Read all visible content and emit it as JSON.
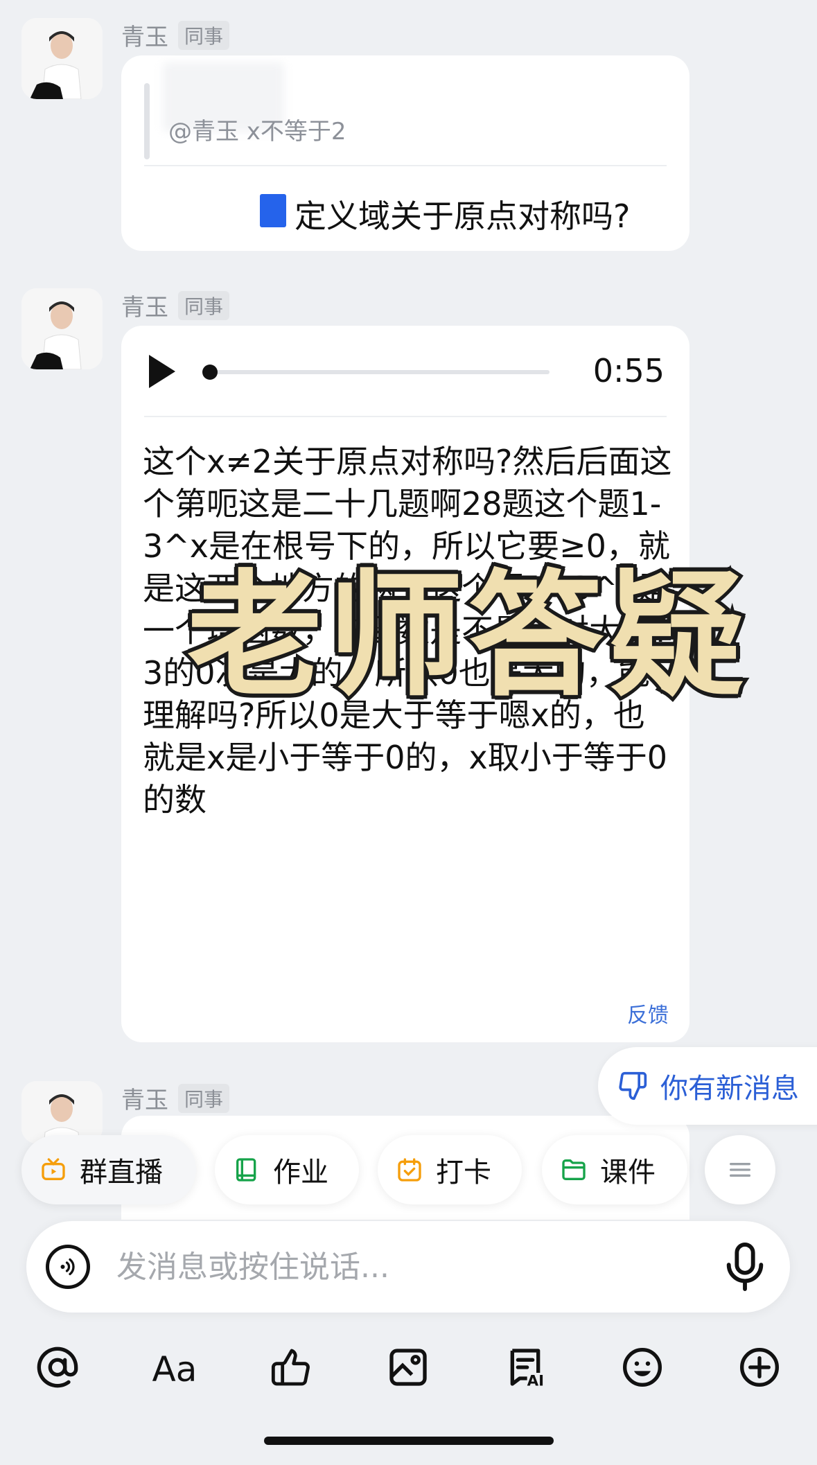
{
  "messages": [
    {
      "sender": "青玉",
      "badge": "同事",
      "quote_text": "@青玉 x不等于2",
      "reply_text": "定义域关于原点对称吗?"
    },
    {
      "sender": "青玉",
      "badge": "同事",
      "voice_duration": "0:55",
      "voice_progress": 0,
      "transcript": "这个x≠2关于原点对称吗?然后后面这个第呃这是二十几题啊28题这个题1-3^x是在根号下的，所以它要≥0，就是这两个地方的两个这个嗯y=3^x是一个增函数，增函数是不是大对大呀?3的0次是大的，所以0也是大的，能理解吗?所以0是大于等于嗯x的，也就是x是小于等于0的，x取小于等于0的数",
      "feedback_label": "反馈"
    },
    {
      "sender": "青玉",
      "badge": "同事"
    }
  ],
  "overlay_title": "老师答疑",
  "new_message_label": "你有新消息",
  "quick_actions": [
    {
      "label": "群直播",
      "icon": "live-tv-icon",
      "color": "#f59e0b"
    },
    {
      "label": "作业",
      "icon": "book-icon",
      "color": "#16a34a"
    },
    {
      "label": "打卡",
      "icon": "calendar-check-icon",
      "color": "#f59e0b"
    },
    {
      "label": "课件",
      "icon": "folder-icon",
      "color": "#16a34a"
    }
  ],
  "input": {
    "placeholder": "发消息或按住说话..."
  },
  "toolbar": [
    {
      "icon": "at-icon"
    },
    {
      "icon": "text-format-icon",
      "label": "Aa"
    },
    {
      "icon": "thumbs-up-icon"
    },
    {
      "icon": "image-icon"
    },
    {
      "icon": "ai-writing-icon",
      "label": "AI"
    },
    {
      "icon": "emoji-icon"
    },
    {
      "icon": "plus-icon"
    }
  ]
}
